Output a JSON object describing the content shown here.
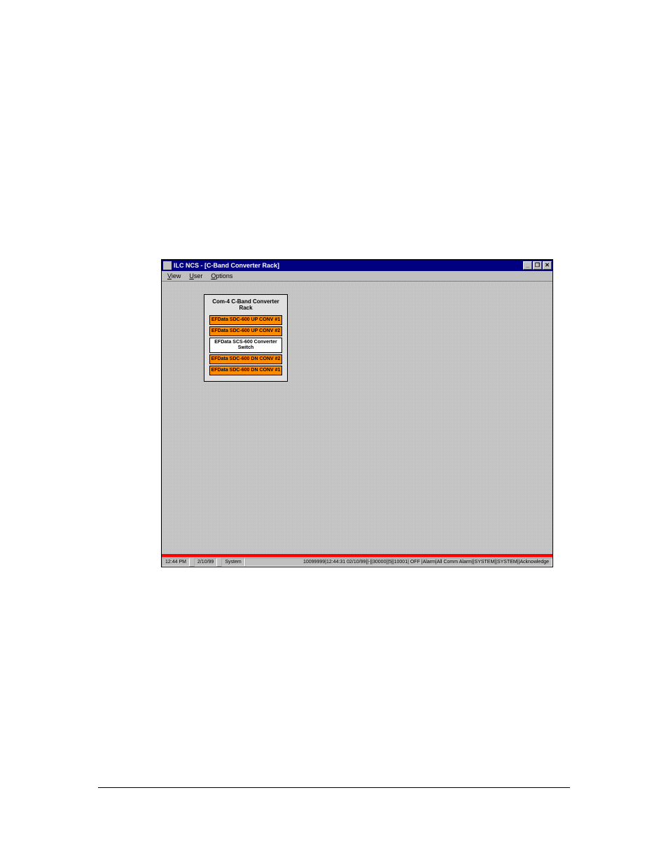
{
  "window": {
    "title": "ILC NCS - [C-Band Converter Rack]",
    "controls": {
      "min": "_",
      "max": "❐",
      "close": "✕"
    }
  },
  "menus": {
    "items": [
      {
        "hot": "V",
        "rest": "iew"
      },
      {
        "hot": "U",
        "rest": "ser"
      },
      {
        "hot": "O",
        "rest": "ptions"
      }
    ]
  },
  "rack": {
    "title": "Com-4 C-Band Converter Rack",
    "items": [
      {
        "label": "EFData SDC-600 UP CONV #1",
        "style": "orange"
      },
      {
        "label": "EFData SDC-600 UP CONV #2",
        "style": "orange"
      },
      {
        "label": "EFData SCS-600 Converter Switch",
        "style": "white"
      },
      {
        "label": "EFData SDC-600 DN CONV #2",
        "style": "orange"
      },
      {
        "label": "EFData SDC-600 DN CONV #1",
        "style": "orange"
      }
    ]
  },
  "statusbar": {
    "time": "12:44 PM",
    "date": "2/10/99",
    "user": "System",
    "message": "10099999|12:44:31 02/10/99||-||30000||5||10001| OFF |Alarm|All Comm Alarm||SYSTEM||SYSTEM||Acknowledge"
  }
}
